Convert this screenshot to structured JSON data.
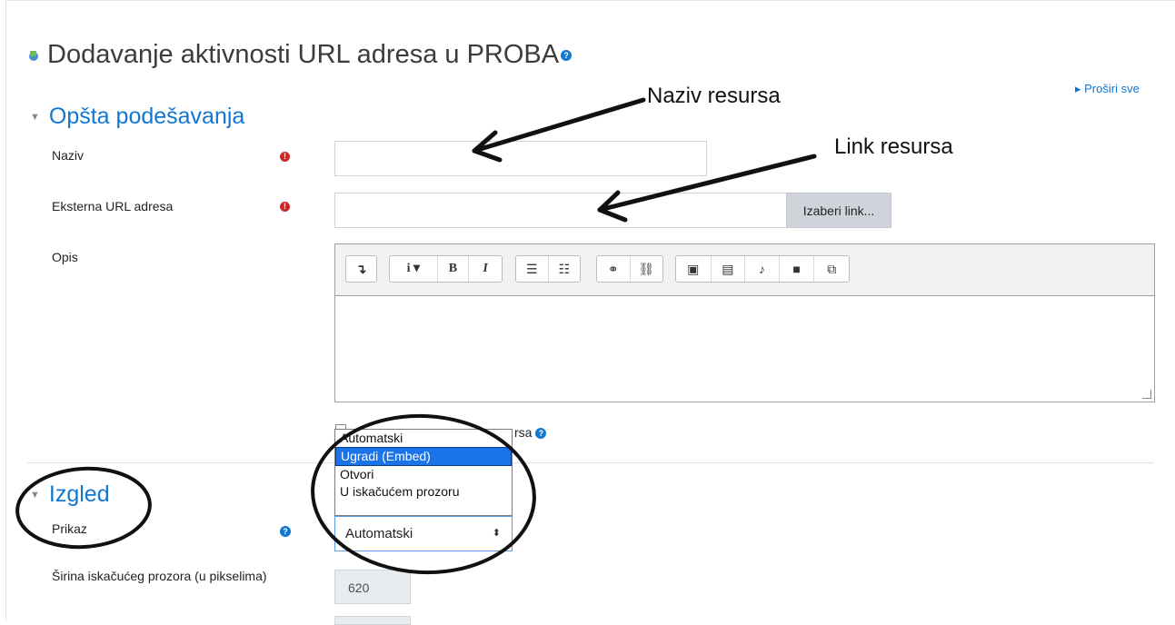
{
  "page": {
    "title": "Dodavanje aktivnosti URL adresa u PROBA",
    "expand_all": "▸ Proširi sve"
  },
  "sections": {
    "general": {
      "title": "Opšta podešavanja"
    },
    "appearance": {
      "title": "Izgled"
    }
  },
  "fields": {
    "name": {
      "label": "Naziv",
      "value": ""
    },
    "external_url": {
      "label": "Eksterna URL adresa",
      "value": "",
      "choose_link_label": "Izaberi link..."
    },
    "description": {
      "label": "Opis",
      "value": ""
    },
    "display_description": {
      "label_visible_part": "rsa"
    },
    "display": {
      "label": "Prikaz",
      "selected": "Automatski",
      "options": [
        "Automatski",
        "Ugradi (Embed)",
        "Otvori",
        "U iskačućem prozoru"
      ],
      "highlighted_option": "Ugradi (Embed)"
    },
    "popup_width": {
      "label": "Širina iskačućeg prozora (u pikselima)",
      "value": "620"
    }
  },
  "editor_toolbar": {
    "groups": [
      [
        "collapse-icon"
      ],
      [
        "info-dropdown-icon",
        "bold-icon",
        "italic-icon"
      ],
      [
        "unordered-list-icon",
        "ordered-list-icon"
      ],
      [
        "link-icon",
        "unlink-icon"
      ],
      [
        "image-icon",
        "media-icon",
        "record-audio-icon",
        "record-video-icon",
        "manage-files-icon"
      ]
    ],
    "labels": {
      "collapse": "↴",
      "info": "i ▾",
      "bold": "B",
      "italic": "I",
      "ul": "☰",
      "ol": "☷",
      "link": "⚭",
      "unlink": "⛓",
      "image": "▣",
      "media": "▤",
      "audio": "♪",
      "video": "■",
      "files": "⧉"
    }
  },
  "annotations": {
    "naziv_resursa": "Naziv resursa",
    "link_resursa": "Link resursa"
  },
  "colors": {
    "accent": "#1177d1",
    "required": "#c52b2b",
    "selected_option": "#1a73e8"
  }
}
